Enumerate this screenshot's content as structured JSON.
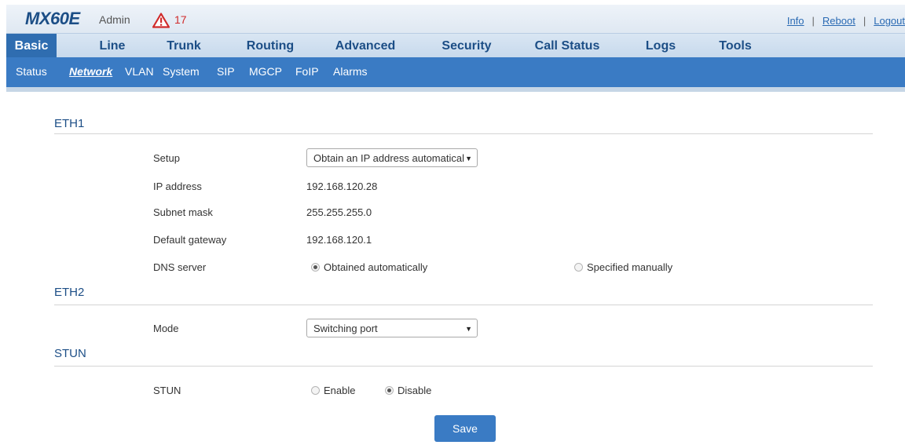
{
  "header": {
    "logo": "MX60E",
    "user": "Admin",
    "alarm_count": "17",
    "links": {
      "info": "Info",
      "reboot": "Reboot",
      "logout": "Logout"
    }
  },
  "main_nav": [
    {
      "label": "Basic",
      "active": true
    },
    {
      "label": "Line"
    },
    {
      "label": "Trunk"
    },
    {
      "label": "Routing"
    },
    {
      "label": "Advanced"
    },
    {
      "label": "Security"
    },
    {
      "label": "Call Status"
    },
    {
      "label": "Logs"
    },
    {
      "label": "Tools"
    }
  ],
  "sub_nav": [
    {
      "label": "Status"
    },
    {
      "label": "Network",
      "active": true
    },
    {
      "label": "VLAN"
    },
    {
      "label": "System"
    },
    {
      "label": "SIP"
    },
    {
      "label": "MGCP"
    },
    {
      "label": "FoIP"
    },
    {
      "label": "Alarms"
    }
  ],
  "eth1": {
    "title": "ETH1",
    "setup_label": "Setup",
    "setup_value": "Obtain an IP address automatically",
    "ip_label": "IP address",
    "ip_value": "192.168.120.28",
    "mask_label": "Subnet mask",
    "mask_value": "255.255.255.0",
    "gateway_label": "Default gateway",
    "gateway_value": "192.168.120.1",
    "dns_label": "DNS server",
    "dns_auto": "Obtained automatically",
    "dns_manual": "Specified manually",
    "dns_selected": "auto"
  },
  "eth2": {
    "title": "ETH2",
    "mode_label": "Mode",
    "mode_value": "Switching port"
  },
  "stun": {
    "title": "STUN",
    "label": "STUN",
    "enable": "Enable",
    "disable": "Disable",
    "selected": "disable"
  },
  "save_label": "Save",
  "colors": {
    "brand": "#1c4e86",
    "active_tab": "#2f6db0",
    "subnav": "#3a7bc4",
    "alarm": "#d02b2b"
  }
}
